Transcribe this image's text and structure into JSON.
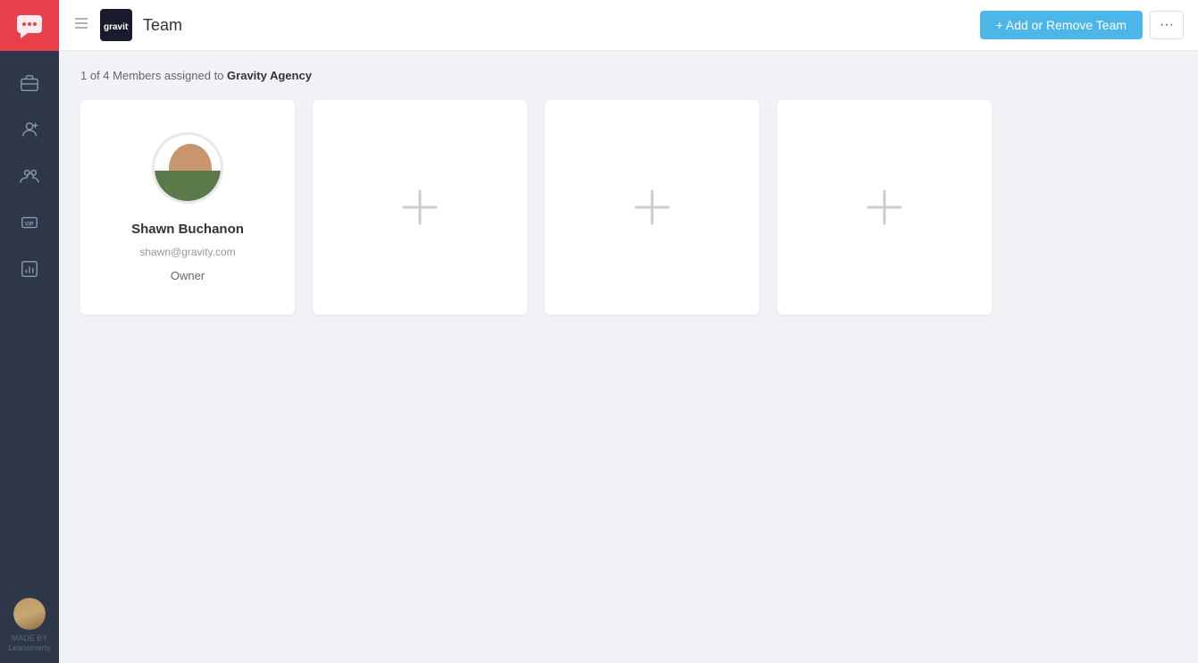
{
  "sidebar": {
    "logo_text": "💬",
    "nav_items": [
      {
        "name": "briefcase-icon",
        "label": "Briefcase"
      },
      {
        "name": "contacts-icon",
        "label": "Contacts"
      },
      {
        "name": "team-icon",
        "label": "Team"
      },
      {
        "name": "vip-icon",
        "label": "VIP"
      },
      {
        "name": "reports-icon",
        "label": "Reports"
      }
    ],
    "made_by_line1": "MADE BY",
    "made_by_line2": "Leanomerty"
  },
  "topbar": {
    "brand_text": "gravity",
    "title": "Team",
    "add_button_label": "+ Add or Remove Team",
    "more_button_label": "···"
  },
  "content": {
    "members_count_text": "1 of 4 Members assigned to",
    "agency_name": "Gravity Agency",
    "member": {
      "name": "Shawn Buchanon",
      "email": "shawn@gravity.com",
      "role": "Owner"
    },
    "add_slots": 3
  }
}
